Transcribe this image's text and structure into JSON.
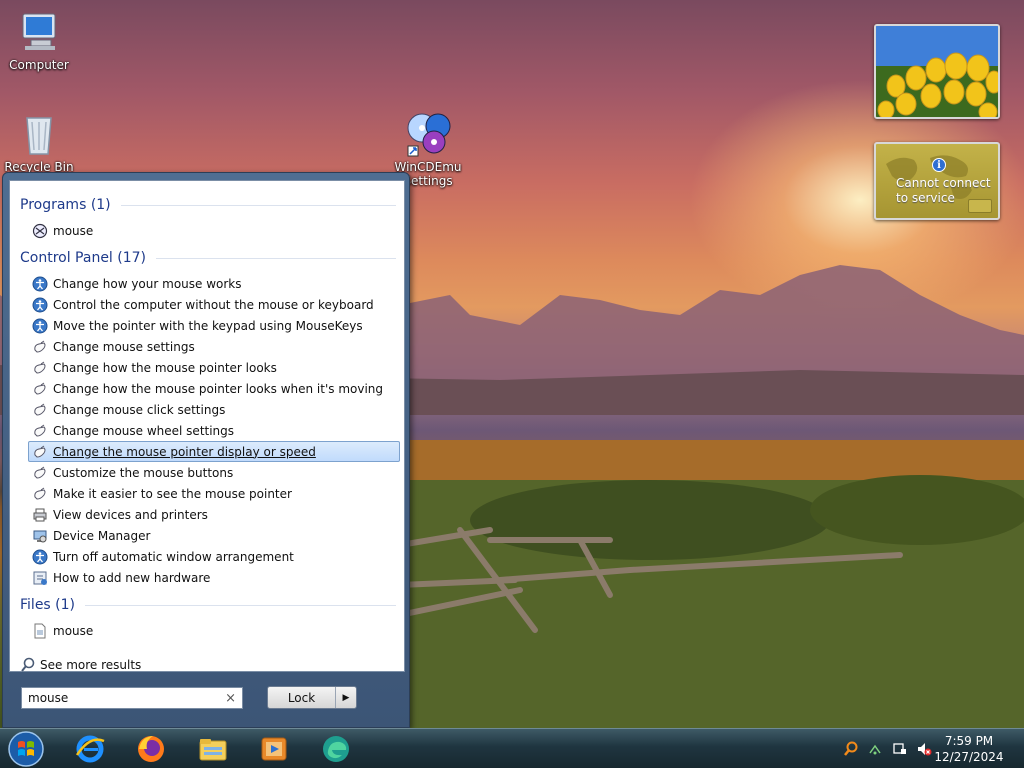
{
  "desktop": {
    "icons": [
      {
        "label": "Computer"
      },
      {
        "label": "Recycle Bin"
      },
      {
        "label": "WinCDEmu Settings"
      }
    ],
    "weather_gadget": {
      "message": "Cannot connect to service"
    }
  },
  "start_menu": {
    "programs": {
      "header": "Programs (1)",
      "items": [
        {
          "label": "mouse",
          "icon": "mouse-program-icon"
        }
      ]
    },
    "control_panel": {
      "header": "Control Panel (17)",
      "items": [
        {
          "label": "Change how your mouse works",
          "icon": "ease-of-access-icon"
        },
        {
          "label": "Control the computer without the mouse or keyboard",
          "icon": "ease-of-access-icon"
        },
        {
          "label": "Move the pointer with the keypad using MouseKeys",
          "icon": "ease-of-access-icon"
        },
        {
          "label": "Change mouse settings",
          "icon": "mouse-icon"
        },
        {
          "label": "Change how the mouse pointer looks",
          "icon": "mouse-icon"
        },
        {
          "label": "Change how the mouse pointer looks when it's moving",
          "icon": "mouse-icon"
        },
        {
          "label": "Change mouse click settings",
          "icon": "mouse-icon"
        },
        {
          "label": "Change mouse wheel settings",
          "icon": "mouse-icon"
        },
        {
          "label": "Change the mouse pointer display or speed",
          "icon": "mouse-icon",
          "selected": true
        },
        {
          "label": "Customize the mouse buttons",
          "icon": "mouse-icon"
        },
        {
          "label": "Make it easier to see the mouse pointer",
          "icon": "mouse-icon"
        },
        {
          "label": "View devices and printers",
          "icon": "printer-icon"
        },
        {
          "label": "Device Manager",
          "icon": "device-manager-icon"
        },
        {
          "label": "Turn off automatic window arrangement",
          "icon": "ease-of-access-icon"
        },
        {
          "label": "How to add new hardware",
          "icon": "hardware-icon"
        }
      ]
    },
    "files": {
      "header": "Files (1)",
      "items": [
        {
          "label": "mouse",
          "icon": "file-icon"
        }
      ]
    },
    "see_more": "See more results",
    "search": {
      "value": "mouse",
      "clear": "×"
    },
    "power_button": {
      "label": "Lock",
      "arrow": "▶"
    }
  },
  "taskbar": {
    "start": "start-orb-icon",
    "pinned": [
      "internet-explorer-icon",
      "firefox-icon",
      "file-explorer-icon",
      "media-player-icon",
      "edge-icon"
    ],
    "clock": {
      "time": "7:59 PM",
      "date": "12/27/2024"
    }
  }
}
